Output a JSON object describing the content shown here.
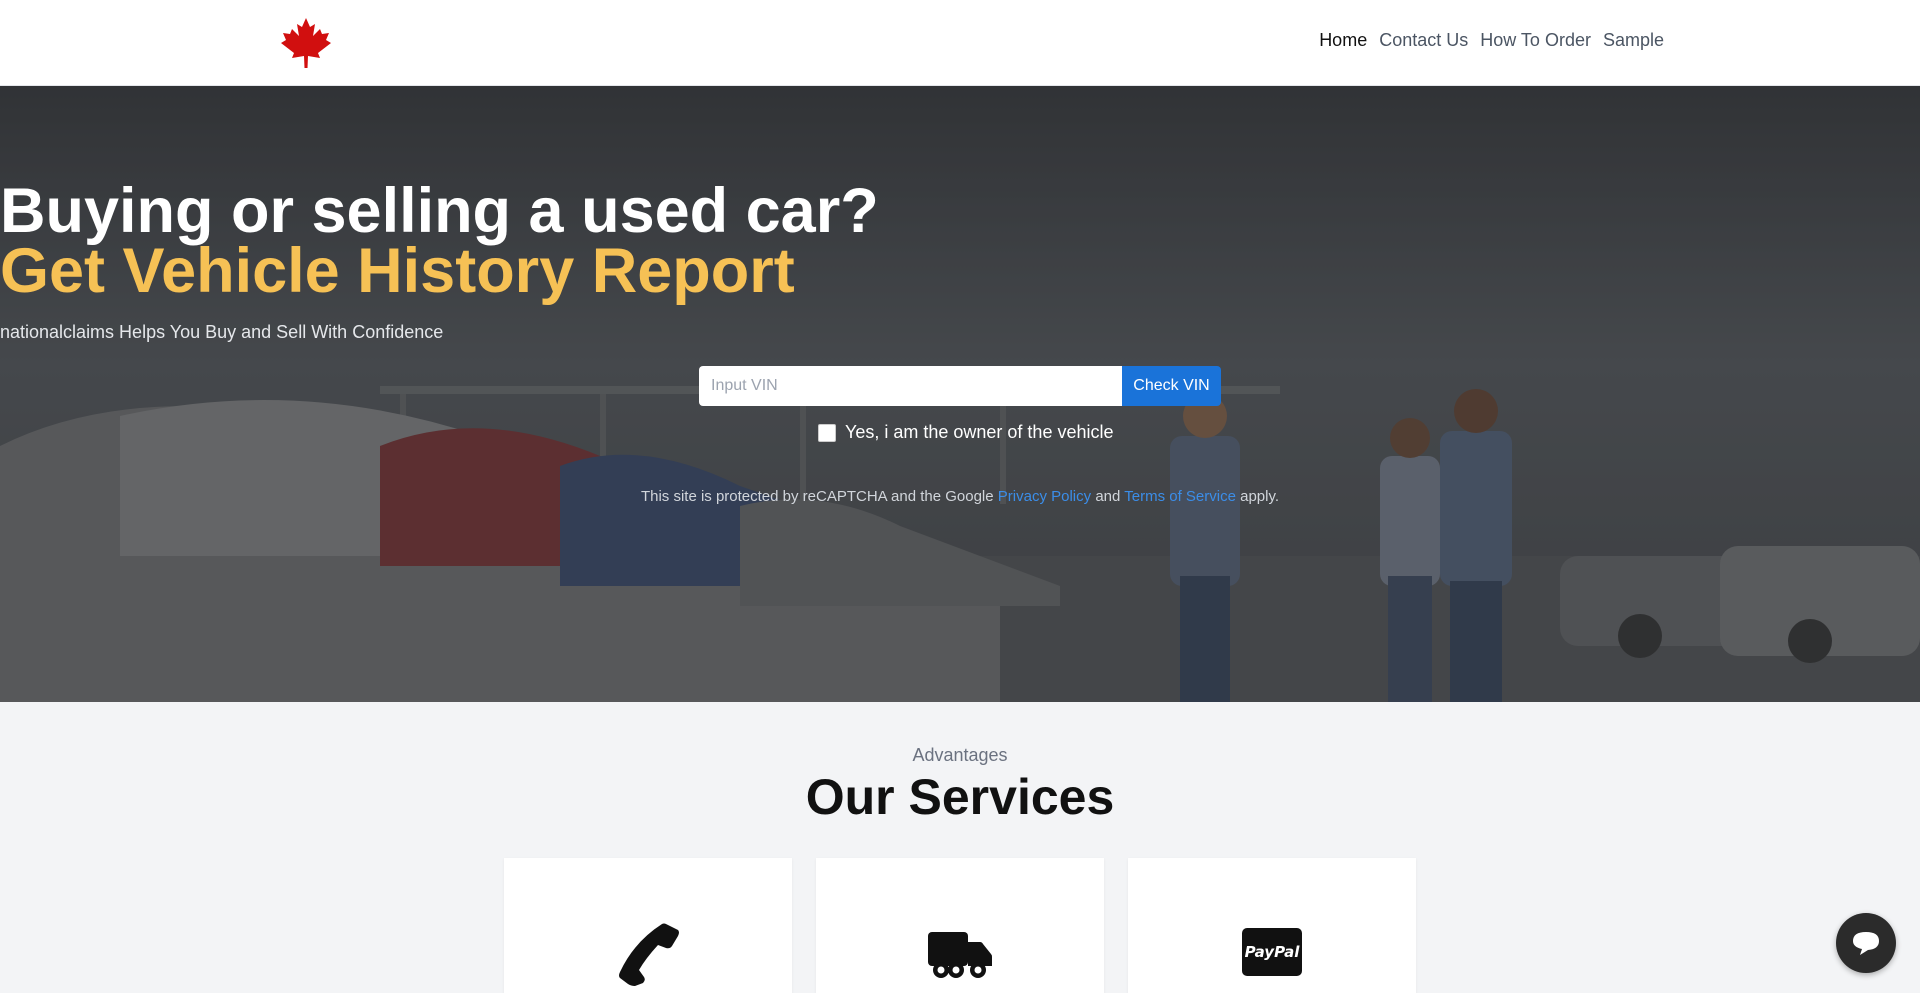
{
  "header": {
    "nav": [
      {
        "label": "Home",
        "active": true
      },
      {
        "label": "Contact Us",
        "active": false
      },
      {
        "label": "How To Order",
        "active": false
      },
      {
        "label": "Sample",
        "active": false
      }
    ],
    "logo_icon": "maple-leaf-icon"
  },
  "hero": {
    "title_line1": "Buying or selling a used car?",
    "title_line2": "Get Vehicle History Report",
    "subtitle": "nationalclaims Helps You Buy and Sell With Confidence",
    "vin_placeholder": "Input VIN",
    "vin_value": "",
    "check_button": "Check VIN",
    "owner_checkbox_label": "Yes, i am the owner of the vehicle",
    "owner_checked": false,
    "recaptcha_prefix": "This site is protected by reCAPTCHA and the Google",
    "privacy_link": "Privacy Policy",
    "recaptcha_and": "and",
    "terms_link": "Terms of Service",
    "recaptcha_suffix": "apply."
  },
  "services": {
    "kicker": "Advantages",
    "title": "Our Services",
    "cards": [
      {
        "icon": "phone-icon"
      },
      {
        "icon": "truck-icon"
      },
      {
        "icon": "paypal-icon"
      }
    ]
  },
  "colors": {
    "accent_yellow": "#f6c155",
    "button_blue": "#1a73d9",
    "link_blue": "#3b8de8",
    "logo_red": "#d10f0f"
  },
  "chat": {
    "icon": "chat-icon"
  }
}
